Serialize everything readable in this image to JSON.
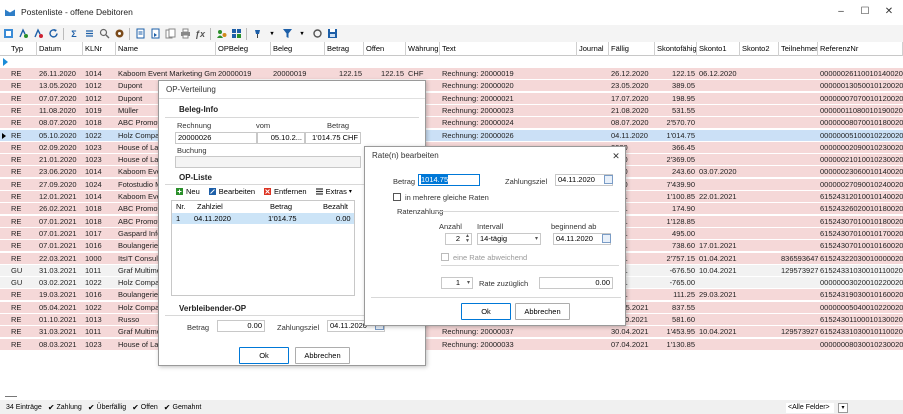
{
  "window": {
    "title": "Postenliste - offene Debitoren",
    "minimize": "–",
    "maximize": "☐",
    "close": "✕"
  },
  "toolbar": {
    "icons": [
      "filter-icon",
      "filter-add-icon",
      "filter-remove-icon",
      "refresh-icon",
      "sum-icon",
      "list-icon",
      "search-icon",
      "settings-icon",
      "document-icon",
      "document-view-icon",
      "document-copy-icon",
      "print-icon",
      "formula-icon",
      "user-settings-icon",
      "group-icon",
      "pin-icon",
      "funnel-icon",
      "circle-icon",
      "save-icon"
    ]
  },
  "grid": {
    "columns": [
      "Typ",
      "Datum",
      "KLNr",
      "Name",
      "OPBeleg",
      "Beleg",
      "Betrag",
      "Offen",
      "Währung",
      "Text",
      "Journal",
      "Fällig",
      "Skontofähig",
      "Skonto1",
      "Skonto2",
      "Teilnehmer",
      "ReferenzNr"
    ],
    "rows": [
      {
        "typ": "RE",
        "datum": "26.11.2020",
        "klnr": "1014",
        "name": "Kaboom Event Marketing Gmb",
        "opbeleg": "20000019",
        "beleg": "20000019",
        "betrag": "122.15",
        "offen": "122.15",
        "waehrung": "CHF",
        "text": "Rechnung: 20000019",
        "faellig": "26.12.2020",
        "skontofaehig": "122.15",
        "skonto1": "06.12.2020",
        "skonto2": "",
        "teilnehmer": "",
        "referenz": "000000261100101400200"
      },
      {
        "typ": "RE",
        "datum": "13.05.2020",
        "klnr": "1012",
        "name": "Dupont",
        "opbeleg": "",
        "beleg": "",
        "betrag": "",
        "offen": "389.05",
        "waehrung": "CHF",
        "text": "Rechnung: 20000020",
        "faellig": "23.05.2020",
        "skontofaehig": "389.05",
        "skonto1": "",
        "skonto2": "",
        "teilnehmer": "",
        "referenz": "000000130500101200200"
      },
      {
        "typ": "RE",
        "datum": "07.07.2020",
        "klnr": "1012",
        "name": "Dupont",
        "opbeleg": "",
        "beleg": "",
        "betrag": "",
        "offen": "198.95",
        "waehrung": "CHF",
        "text": "Rechnung: 20000021",
        "faellig": "17.07.2020",
        "skontofaehig": "198.95",
        "skonto1": "",
        "skonto2": "",
        "teilnehmer": "",
        "referenz": "000000070700101200200"
      },
      {
        "typ": "RE",
        "datum": "11.08.2020",
        "klnr": "1019",
        "name": "Müller",
        "opbeleg": "",
        "beleg": "",
        "betrag": "",
        "offen": "531.55",
        "waehrung": "CHF",
        "text": "Rechnung: 20000023",
        "faellig": "21.08.2020",
        "skontofaehig": "531.55",
        "skonto1": "",
        "skonto2": "",
        "teilnehmer": "",
        "referenz": "000000110800101900200"
      },
      {
        "typ": "RE",
        "datum": "08.07.2020",
        "klnr": "1018",
        "name": "ABC Promotions",
        "opbeleg": "",
        "beleg": "",
        "betrag": "",
        "offen": "2'570.70",
        "waehrung": "CHF",
        "text": "Rechnung: 20000024",
        "faellig": "08.07.2020",
        "skontofaehig": "2'570.70",
        "skonto1": "",
        "skonto2": "",
        "teilnehmer": "",
        "referenz": "000000080700101800200"
      },
      {
        "typ": "RE",
        "datum": "05.10.2020",
        "klnr": "1022",
        "name": "Holz Company",
        "opbeleg": "",
        "beleg": "",
        "betrag": "",
        "offen": "1'014.75",
        "waehrung": "CHF",
        "text": "Rechnung: 20000026",
        "faellig": "04.11.2020",
        "skontofaehig": "1'014.75",
        "skonto1": "",
        "skonto2": "",
        "teilnehmer": "",
        "referenz": "000000051000102200200"
      },
      {
        "typ": "RE",
        "datum": "02.09.2020",
        "klnr": "1023",
        "name": "House of Lacke",
        "opbeleg": "",
        "beleg": "",
        "betrag": "",
        "offen": "366.45",
        "waehrung": "",
        "text": "",
        "faellig": "2020",
        "skontofaehig": "366.45",
        "skonto1": "",
        "skonto2": "",
        "teilnehmer": "",
        "referenz": "000000020900102300200"
      },
      {
        "typ": "RE",
        "datum": "21.01.2020",
        "klnr": "1023",
        "name": "House of Lacke",
        "opbeleg": "",
        "beleg": "",
        "betrag": "",
        "offen": "2'369.05",
        "waehrung": "",
        "text": "",
        "faellig": "2020",
        "skontofaehig": "2'369.05",
        "skonto1": "",
        "skonto2": "",
        "teilnehmer": "",
        "referenz": "000000210100102300200"
      },
      {
        "typ": "RE",
        "datum": "23.06.2020",
        "klnr": "1014",
        "name": "Kaboom Event",
        "opbeleg": "",
        "beleg": "",
        "betrag": "",
        "offen": "243.60",
        "waehrung": "",
        "text": "",
        "faellig": "2020",
        "skontofaehig": "243.60",
        "skonto1": "03.07.2020",
        "skonto2": "",
        "teilnehmer": "",
        "referenz": "000000230600101400200"
      },
      {
        "typ": "RE",
        "datum": "27.09.2020",
        "klnr": "1024",
        "name": "Fotostudio Meie",
        "opbeleg": "",
        "beleg": "",
        "betrag": "",
        "offen": "7'439.90",
        "waehrung": "",
        "text": "",
        "faellig": "2020",
        "skontofaehig": "7'439.90",
        "skonto1": "",
        "skonto2": "",
        "teilnehmer": "",
        "referenz": "000000270900102400200"
      },
      {
        "typ": "RE",
        "datum": "12.01.2021",
        "klnr": "1014",
        "name": "Kaboom Event",
        "opbeleg": "",
        "beleg": "",
        "betrag": "",
        "offen": "1'100.85",
        "waehrung": "",
        "text": "",
        "faellig": "2021",
        "skontofaehig": "1'100.85",
        "skonto1": "22.01.2021",
        "skonto2": "",
        "teilnehmer": "",
        "referenz": "615243120100101400200"
      },
      {
        "typ": "RE",
        "datum": "26.02.2021",
        "klnr": "1018",
        "name": "ABC Promotions",
        "opbeleg": "",
        "beleg": "",
        "betrag": "",
        "offen": "174.90",
        "waehrung": "",
        "text": "",
        "faellig": "2021",
        "skontofaehig": "174.90",
        "skonto1": "",
        "skonto2": "",
        "teilnehmer": "",
        "referenz": "615243260200101800200"
      },
      {
        "typ": "RE",
        "datum": "07.01.2021",
        "klnr": "1018",
        "name": "ABC Promotions",
        "opbeleg": "",
        "beleg": "",
        "betrag": "",
        "offen": "1'128.85",
        "waehrung": "",
        "text": "",
        "faellig": "2021",
        "skontofaehig": "1'128.85",
        "skonto1": "",
        "skonto2": "",
        "teilnehmer": "",
        "referenz": "615243070100101800200"
      },
      {
        "typ": "RE",
        "datum": "07.01.2021",
        "klnr": "1017",
        "name": "Gaspard Inform",
        "opbeleg": "",
        "beleg": "",
        "betrag": "",
        "offen": "495.00",
        "waehrung": "",
        "text": "",
        "faellig": "2021",
        "skontofaehig": "495.00",
        "skonto1": "",
        "skonto2": "",
        "teilnehmer": "",
        "referenz": "615243070100101700200"
      },
      {
        "typ": "RE",
        "datum": "07.01.2021",
        "klnr": "1016",
        "name": "Boulangerie Chi",
        "opbeleg": "",
        "beleg": "",
        "betrag": "",
        "offen": "738.60",
        "waehrung": "",
        "text": "",
        "faellig": "2021",
        "skontofaehig": "738.60",
        "skonto1": "17.01.2021",
        "skonto2": "",
        "teilnehmer": "",
        "referenz": "615243070100101600200"
      },
      {
        "typ": "RE",
        "datum": "22.03.2021",
        "klnr": "1000",
        "name": "ItsIT Consulting",
        "opbeleg": "",
        "beleg": "",
        "betrag": "",
        "offen": "2'757.15",
        "waehrung": "",
        "text": "",
        "faellig": "2021",
        "skontofaehig": "2'757.15",
        "skonto1": "01.04.2021",
        "skonto2": "",
        "teilnehmer": "836593647",
        "referenz": "615243220300100000200"
      },
      {
        "typ": "GU",
        "datum": "31.03.2021",
        "klnr": "1011",
        "name": "Graf Multimedia",
        "opbeleg": "",
        "beleg": "",
        "betrag": "",
        "offen": "-676.50",
        "waehrung": "",
        "text": "",
        "faellig": "2021",
        "skontofaehig": "-676.50",
        "skonto1": "10.04.2021",
        "skonto2": "",
        "teilnehmer": "129573927",
        "referenz": "615243310300101100200"
      },
      {
        "typ": "GU",
        "datum": "03.02.2021",
        "klnr": "1022",
        "name": "Holz Company",
        "opbeleg": "",
        "beleg": "",
        "betrag": "",
        "offen": "-765.00",
        "waehrung": "",
        "text": "",
        "faellig": "2021",
        "skontofaehig": "-765.00",
        "skonto1": "",
        "skonto2": "",
        "teilnehmer": "",
        "referenz": "000000030200102200200"
      },
      {
        "typ": "RE",
        "datum": "19.03.2021",
        "klnr": "1016",
        "name": "Boulangerie Chi",
        "opbeleg": "",
        "beleg": "",
        "betrag": "",
        "offen": "111.25",
        "waehrung": "",
        "text": "",
        "faellig": "2021",
        "skontofaehig": "111.25",
        "skonto1": "29.03.2021",
        "skonto2": "",
        "teilnehmer": "",
        "referenz": "615243190300101600200"
      },
      {
        "typ": "RE",
        "datum": "05.04.2021",
        "klnr": "1022",
        "name": "Holz Company",
        "opbeleg": "",
        "beleg": "",
        "betrag": "",
        "offen": "837.55",
        "waehrung": "CHF",
        "text": "Teilrechnung: 20000007",
        "faellig": "05.05.2021",
        "skontofaehig": "837.55",
        "skonto1": "",
        "skonto2": "",
        "teilnehmer": "",
        "referenz": "000000050400102200200"
      },
      {
        "typ": "RE",
        "datum": "01.10.2021",
        "klnr": "1013",
        "name": "Russo",
        "opbeleg": "",
        "beleg": "",
        "betrag": "",
        "offen": "581.60",
        "waehrung": "CHF",
        "text": "Rechnung: 20000041",
        "faellig": "11.10.2021",
        "skontofaehig": "581.60",
        "skonto1": "",
        "skonto2": "",
        "teilnehmer": "",
        "referenz": "615243011000101300200"
      },
      {
        "typ": "RE",
        "datum": "31.03.2021",
        "klnr": "1011",
        "name": "Graf Multimedia",
        "opbeleg": "",
        "beleg": "",
        "betrag": "",
        "offen": "1'453.95",
        "waehrung": "CHF",
        "text": "Rechnung: 20000037",
        "faellig": "30.04.2021",
        "skontofaehig": "1'453.95",
        "skonto1": "10.04.2021",
        "skonto2": "",
        "teilnehmer": "129573927",
        "referenz": "615243310300101100200"
      },
      {
        "typ": "RE",
        "datum": "08.03.2021",
        "klnr": "1023",
        "name": "House of Lacke",
        "opbeleg": "20000033",
        "beleg": "20000033",
        "betrag": "1'130.85",
        "offen": "1'130.85",
        "waehrung": "CHF",
        "text": "Rechnung: 20000033",
        "faellig": "07.04.2021",
        "skontofaehig": "1'130.85",
        "skonto1": "",
        "skonto2": "",
        "teilnehmer": "",
        "referenz": "000000080300102300200"
      }
    ]
  },
  "op_dialog": {
    "title": "OP-Verteilung",
    "beleg_info": "Beleg-Info",
    "rechnung_label": "Rechnung",
    "vom_label": "vom",
    "betrag_label": "Betrag",
    "rechnung_value": "20000026",
    "vom_value": "05.10.2...",
    "betrag_value": "1'014.75 CHF",
    "buchung_label": "Buchung",
    "op_liste": "OP-Liste",
    "neu": "Neu",
    "bearbeiten": "Bearbeiten",
    "entfernen": "Entfernen",
    "extras": "Extras",
    "table_headers": [
      "Nr.",
      "Zahlziel",
      "Betrag",
      "Bezahlt"
    ],
    "table_row": {
      "nr": "1",
      "zahlziel": "04.11.2020",
      "betrag": "1'014.75",
      "bezahlt": "0.00"
    },
    "verbleibender_op": "Verbleibender-OP",
    "betrag_rest_label": "Betrag",
    "betrag_rest_value": "0.00",
    "zahlungsziel_label": "Zahlungsziel",
    "zahlungsziel_value": "04.11.2020",
    "ok": "Ok",
    "abbrechen": "Abbrechen"
  },
  "rate_dialog": {
    "title": "Rate(n) bearbeiten",
    "betrag_label": "Betrag",
    "betrag_value": "1014.75",
    "zahlungsziel_label": "Zahlungsziel",
    "zahlungsziel_value": "04.11.2020",
    "mehrere_raten": "in mehrere gleiche Raten",
    "ratenzahlung": "Ratenzahlung",
    "anzahl_label": "Anzahl",
    "anzahl_value": "2",
    "intervall_label": "Intervall",
    "intervall_value": "14-tägig",
    "beginnend_label": "beginnend ab",
    "beginnend_value": "04.11.2020",
    "abweichend": "eine Rate abweichend",
    "rate_zuzueglich_count": "1",
    "rate_zuzueglich_label": "Rate zuzüglich",
    "rate_zuzueglich_value": "0.00",
    "ok": "Ok",
    "abbrechen": "Abbrechen",
    "close": "✕"
  },
  "statusbar": {
    "eintraege": "34 Einträge",
    "zahlung": "Zahlung",
    "ueberfaellig": "Überfällig",
    "offen": "Offen",
    "gemahnt": "Gemahnt",
    "filter": "<Alle Felder>"
  },
  "colors": {
    "row_re": "#f5d8d8",
    "row_selected": "#cbe0f6",
    "row_gu": "#f2f2f2",
    "accent": "#0078d7"
  }
}
